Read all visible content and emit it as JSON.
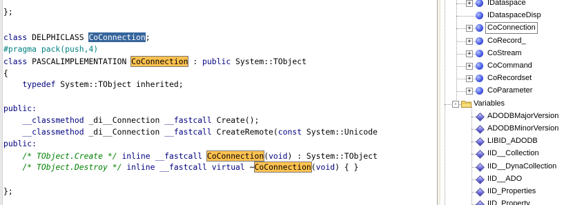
{
  "editor": {
    "lines": [
      {
        "parts": [
          {
            "t": "};",
            "c": ""
          }
        ]
      },
      {
        "parts": []
      },
      {
        "parts": [
          {
            "t": "class",
            "c": "kw"
          },
          {
            "t": " DELPHICLASS ",
            "c": ""
          },
          {
            "t": "CoConnection",
            "c": "sel"
          },
          {
            "t": ";",
            "c": ""
          }
        ]
      },
      {
        "parts": [
          {
            "t": "#pragma pack(push,4)",
            "c": "pp"
          }
        ]
      },
      {
        "parts": [
          {
            "t": "class",
            "c": "kw"
          },
          {
            "t": " PASCALIMPLEMENTATION ",
            "c": ""
          },
          {
            "t": "CoConnection",
            "c": "hl"
          },
          {
            "t": " : ",
            "c": ""
          },
          {
            "t": "public",
            "c": "kw"
          },
          {
            "t": " System::TObject",
            "c": ""
          }
        ]
      },
      {
        "parts": [
          {
            "t": "{",
            "c": ""
          }
        ]
      },
      {
        "parts": [
          {
            "t": "    ",
            "c": ""
          },
          {
            "t": "typedef",
            "c": "kw"
          },
          {
            "t": " System::TObject inherited;",
            "c": ""
          }
        ]
      },
      {
        "parts": []
      },
      {
        "parts": [
          {
            "t": "public:",
            "c": "kw"
          }
        ]
      },
      {
        "parts": [
          {
            "t": "    ",
            "c": ""
          },
          {
            "t": "__classmethod",
            "c": "kw"
          },
          {
            "t": " _di__Connection ",
            "c": ""
          },
          {
            "t": "__fastcall",
            "c": "kw"
          },
          {
            "t": " Create();",
            "c": ""
          }
        ]
      },
      {
        "parts": [
          {
            "t": "    ",
            "c": ""
          },
          {
            "t": "__classmethod",
            "c": "kw"
          },
          {
            "t": " _di__Connection ",
            "c": ""
          },
          {
            "t": "__fastcall",
            "c": "kw"
          },
          {
            "t": " CreateRemote(",
            "c": ""
          },
          {
            "t": "const",
            "c": "kw"
          },
          {
            "t": " System::Unicode",
            "c": ""
          }
        ]
      },
      {
        "parts": [
          {
            "t": "public:",
            "c": "kw"
          }
        ]
      },
      {
        "parts": [
          {
            "t": "    ",
            "c": ""
          },
          {
            "t": "/* TObject.Create */",
            "c": "cm"
          },
          {
            "t": " ",
            "c": ""
          },
          {
            "t": "inline",
            "c": "kw"
          },
          {
            "t": " ",
            "c": ""
          },
          {
            "t": "__fastcall",
            "c": "kw"
          },
          {
            "t": " ",
            "c": ""
          },
          {
            "t": "CoConnection",
            "c": "hl"
          },
          {
            "t": "(",
            "c": ""
          },
          {
            "t": "void",
            "c": "kw"
          },
          {
            "t": ") : System::TObject",
            "c": ""
          }
        ]
      },
      {
        "parts": [
          {
            "t": "    ",
            "c": ""
          },
          {
            "t": "/* TObject.Destroy */",
            "c": "cm"
          },
          {
            "t": " ",
            "c": ""
          },
          {
            "t": "inline",
            "c": "kw"
          },
          {
            "t": " ",
            "c": ""
          },
          {
            "t": "__fastcall",
            "c": "kw"
          },
          {
            "t": " ",
            "c": ""
          },
          {
            "t": "virtual",
            "c": "kw"
          },
          {
            "t": " ~",
            "c": ""
          },
          {
            "t": "CoConnection",
            "c": "hl"
          },
          {
            "t": "(",
            "c": ""
          },
          {
            "t": "void",
            "c": "kw"
          },
          {
            "t": ") { }",
            "c": ""
          }
        ]
      },
      {
        "parts": []
      },
      {
        "parts": [
          {
            "t": "};",
            "c": ""
          }
        ]
      }
    ]
  },
  "tree": {
    "items": [
      {
        "label": "IDataspace",
        "icon": "ball-icon",
        "expander": "+"
      },
      {
        "label": "IDataspaceDisp",
        "icon": "ball-icon",
        "expander": ""
      },
      {
        "label": "CoConnection",
        "icon": "ball-icon",
        "expander": "+",
        "selected": true
      },
      {
        "label": "CoRecord_",
        "icon": "ball-icon",
        "expander": "+"
      },
      {
        "label": "CoStream",
        "icon": "ball-icon",
        "expander": "+"
      },
      {
        "label": "CoCommand",
        "icon": "ball-icon",
        "expander": "+"
      },
      {
        "label": "CoRecordset",
        "icon": "ball-icon",
        "expander": "+"
      },
      {
        "label": "CoParameter",
        "icon": "ball-icon",
        "expander": "+"
      },
      {
        "label": "Variables",
        "icon": "folder-icon",
        "expander": "-",
        "level": 0
      },
      {
        "label": "ADODBMajorVersion",
        "icon": "diamond-icon",
        "expander": ""
      },
      {
        "label": "ADODBMinorVersion",
        "icon": "diamond-icon",
        "expander": ""
      },
      {
        "label": "LIBID_ADODB",
        "icon": "diamond-icon",
        "expander": ""
      },
      {
        "label": "IID__Collection",
        "icon": "diamond-icon",
        "expander": ""
      },
      {
        "label": "IID__DynaCollection",
        "icon": "diamond-icon",
        "expander": ""
      },
      {
        "label": "IID__ADO",
        "icon": "diamond-icon",
        "expander": ""
      },
      {
        "label": "IID_Properties",
        "icon": "diamond-icon",
        "expander": ""
      },
      {
        "label": "IID_Property_",
        "icon": "diamond-icon",
        "expander": ""
      }
    ]
  },
  "colors": {
    "keyword": "#000080",
    "preprocessor": "#008080",
    "comment": "#008000",
    "match_highlight": "#ffc250",
    "selection": "#36659c"
  }
}
